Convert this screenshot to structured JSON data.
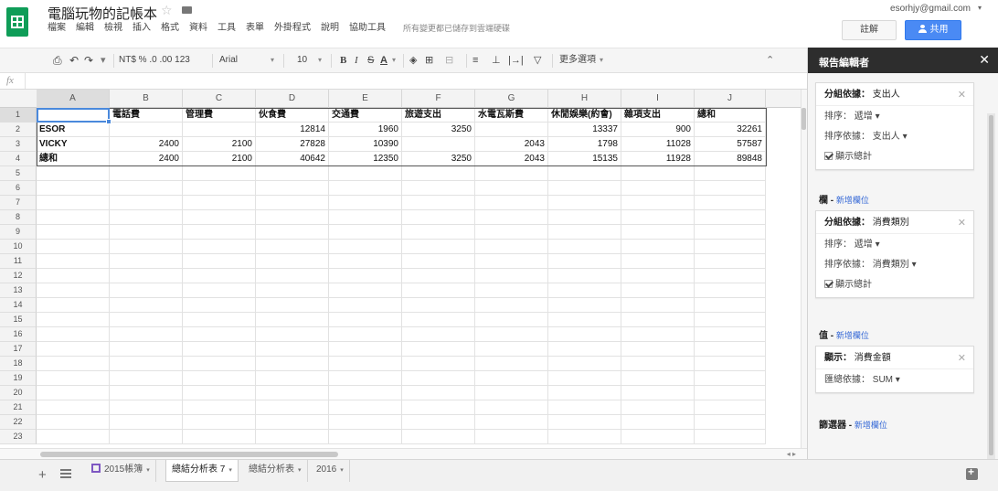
{
  "doc": {
    "title": "電腦玩物的記帳本",
    "account": "esorhjy@gmail.com",
    "saved_note": "所有變更都已儲存到雲端硬碟",
    "comment_label": "註解",
    "share_label": "共用"
  },
  "menu": [
    "檔案",
    "編輯",
    "檢視",
    "插入",
    "格式",
    "資料",
    "工具",
    "表單",
    "外掛程式",
    "說明",
    "協助工具"
  ],
  "toolbar": {
    "format_label": "NT$ % .0 .00 123",
    "font": "Arial",
    "size": "10",
    "more": "更多選項"
  },
  "grid": {
    "columns": [
      "A",
      "B",
      "C",
      "D",
      "E",
      "F",
      "G",
      "H",
      "I",
      "J"
    ],
    "row_numbers": [
      "1",
      "2",
      "3",
      "4",
      "5",
      "6",
      "7",
      "8",
      "9",
      "10",
      "11",
      "12",
      "13",
      "14",
      "15",
      "16",
      "17",
      "18",
      "19",
      "20",
      "21",
      "22",
      "23"
    ],
    "header_row": [
      "",
      "電話費",
      "管理費",
      "伙食費",
      "交通費",
      "旅遊支出",
      "水電瓦斯費",
      "休閒娛樂(約會)",
      "雜項支出",
      "總和"
    ],
    "data_rows": [
      [
        "ESOR",
        "",
        "",
        "12814",
        "1960",
        "3250",
        "",
        "13337",
        "900",
        "32261"
      ],
      [
        "VICKY",
        "2400",
        "2100",
        "27828",
        "10390",
        "",
        "2043",
        "1798",
        "11028",
        "57587"
      ],
      [
        "總和",
        "2400",
        "2100",
        "40642",
        "12350",
        "3250",
        "2043",
        "15135",
        "11928",
        "89848"
      ]
    ]
  },
  "tabs": [
    {
      "label": "2015帳簿",
      "active": false
    },
    {
      "label": "總結分析表 7",
      "active": true
    },
    {
      "label": "總結分析表",
      "active": false
    },
    {
      "label": "2016",
      "active": false
    }
  ],
  "panel": {
    "title": "報告編輯者",
    "rows_card": {
      "group_key": "分組依據：",
      "group_val": "支出人",
      "sort_label": "排序：",
      "sort_val": "遞增",
      "sortby_label": "排序依據：",
      "sortby_val": "支出人",
      "totals": "顯示總計"
    },
    "columns_section": "欄",
    "add_field": "新增欄位",
    "columns_card": {
      "group_key": "分組依據：",
      "group_val": "消費類別",
      "sort_label": "排序：",
      "sort_val": "遞增",
      "sortby_label": "排序依據：",
      "sortby_val": "消費類別",
      "totals": "顯示總計"
    },
    "values_section": "值",
    "values_card": {
      "show_key": "顯示：",
      "show_val": "消費金額",
      "agg_label": "匯總依據：",
      "agg_val": "SUM"
    },
    "filter_section": "篩選器"
  }
}
